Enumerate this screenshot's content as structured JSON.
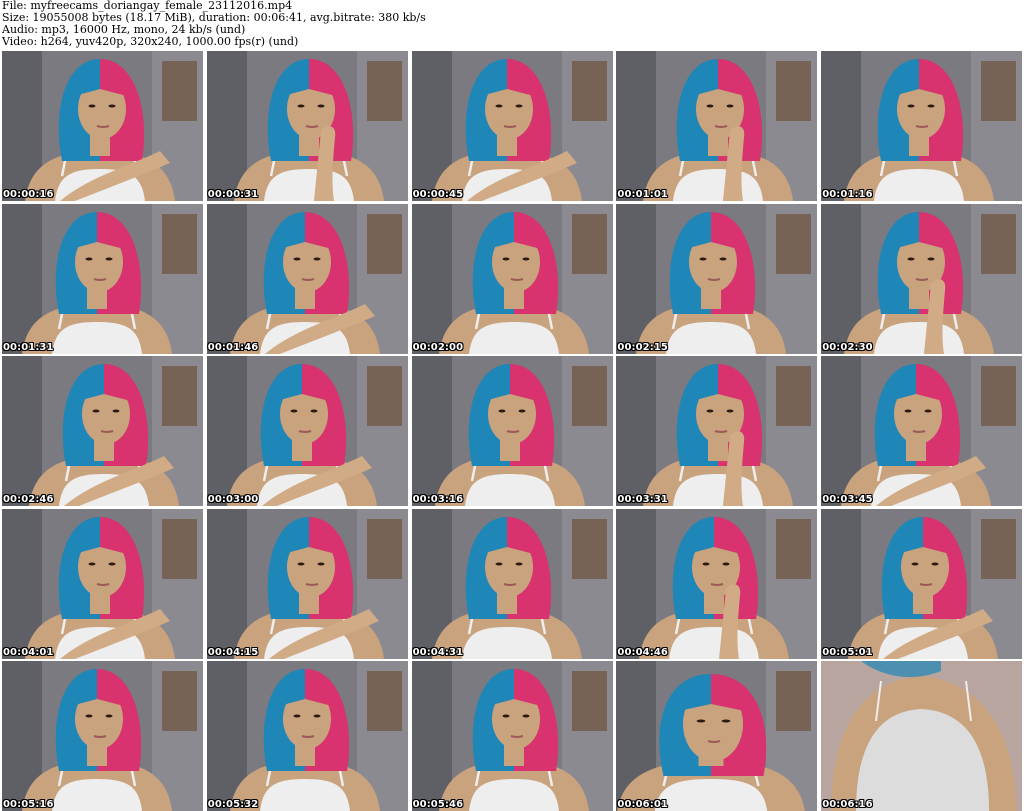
{
  "header": {
    "file_line": "File: myfreecams_doriangay_female_23112016.mp4",
    "size_line": "Size: 19055008 bytes (18.17 MiB), duration: 00:06:41, avg.bitrate: 380 kb/s",
    "audio_line": "Audio: mp3, 16000 Hz, mono, 24 kb/s (und)",
    "video_line": "Video: h264, yuv420p, 320x240, 1000.00 fps(r) (und)"
  },
  "thumbnails": [
    {
      "timestamp": "00:00:16",
      "pose": "hand-on-shoulder",
      "variant": "a"
    },
    {
      "timestamp": "00:00:31",
      "pose": "hand-on-chin",
      "variant": "b"
    },
    {
      "timestamp": "00:00:45",
      "pose": "hand-on-shoulder",
      "variant": "c"
    },
    {
      "timestamp": "00:01:01",
      "pose": "hand-on-chin",
      "variant": "b"
    },
    {
      "timestamp": "00:01:16",
      "pose": "neutral",
      "variant": "a"
    },
    {
      "timestamp": "00:01:31",
      "pose": "neutral",
      "variant": "c"
    },
    {
      "timestamp": "00:01:46",
      "pose": "hand-on-shoulder",
      "variant": "a"
    },
    {
      "timestamp": "00:02:00",
      "pose": "neutral",
      "variant": "b"
    },
    {
      "timestamp": "00:02:15",
      "pose": "neutral",
      "variant": "c"
    },
    {
      "timestamp": "00:02:30",
      "pose": "hand-on-chin",
      "variant": "a"
    },
    {
      "timestamp": "00:02:46",
      "pose": "hand-on-shoulder",
      "variant": "b"
    },
    {
      "timestamp": "00:03:00",
      "pose": "hand-on-shoulder",
      "variant": "c"
    },
    {
      "timestamp": "00:03:16",
      "pose": "neutral",
      "variant": "a"
    },
    {
      "timestamp": "00:03:31",
      "pose": "hand-on-chin",
      "variant": "b"
    },
    {
      "timestamp": "00:03:45",
      "pose": "hand-on-shoulder",
      "variant": "c"
    },
    {
      "timestamp": "00:04:01",
      "pose": "hand-on-shoulder",
      "variant": "a"
    },
    {
      "timestamp": "00:04:15",
      "pose": "hand-on-shoulder",
      "variant": "b"
    },
    {
      "timestamp": "00:04:31",
      "pose": "neutral",
      "variant": "c"
    },
    {
      "timestamp": "00:04:46",
      "pose": "hand-on-chin",
      "variant": "a"
    },
    {
      "timestamp": "00:05:01",
      "pose": "hand-on-shoulder",
      "variant": "b"
    },
    {
      "timestamp": "00:05:16",
      "pose": "neutral",
      "variant": "c"
    },
    {
      "timestamp": "00:05:32",
      "pose": "neutral",
      "variant": "a"
    },
    {
      "timestamp": "00:05:46",
      "pose": "neutral",
      "variant": "b"
    },
    {
      "timestamp": "00:06:01",
      "pose": "close-up",
      "variant": "c"
    },
    {
      "timestamp": "00:06:16",
      "pose": "torso-closeup",
      "variant": "a"
    }
  ],
  "colors": {
    "page_bg": "#ffffff",
    "header_text": "#000000",
    "timestamp_text": "#ffffff",
    "timestamp_outline": "#000000",
    "hair_blue": "#1f86b8",
    "hair_pink": "#d8326f",
    "skin": "#c9a27e",
    "top_white": "#eeeeee",
    "wall_grey": "#7a7a80",
    "frame_brown": "#6b4a2e"
  }
}
